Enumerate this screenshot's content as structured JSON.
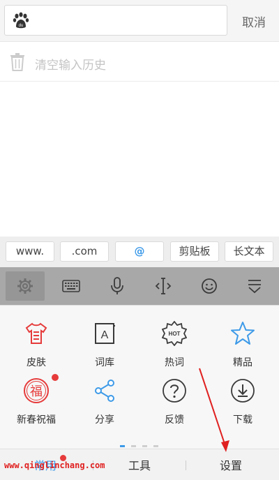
{
  "search": {
    "placeholder": "",
    "cancel_label": "取消"
  },
  "history": {
    "clear_label": "清空输入历史"
  },
  "quick_inputs": [
    "www.",
    ".com",
    "@",
    "剪贴板",
    "长文本"
  ],
  "toolbar": {
    "icons": [
      "gear-icon",
      "keyboard-icon",
      "microphone-icon",
      "cursor-icon",
      "emoji-icon",
      "collapse-icon"
    ],
    "accent": "#3d9ae8"
  },
  "panel": {
    "row1": [
      "皮肤",
      "词库",
      "热词",
      "精品"
    ],
    "row2": [
      "新春祝福",
      "分享",
      "反馈",
      "下载"
    ],
    "hot_badge": "HOT",
    "fortune_char": "福",
    "dict_char": "A"
  },
  "tabs": {
    "common": "常用",
    "tools": "工具",
    "settings": "设置"
  },
  "watermark": "www.qinglinchang.com",
  "colors": {
    "red": "#e63a3a",
    "blue": "#3d9ae8",
    "arrow": "#e02020"
  }
}
